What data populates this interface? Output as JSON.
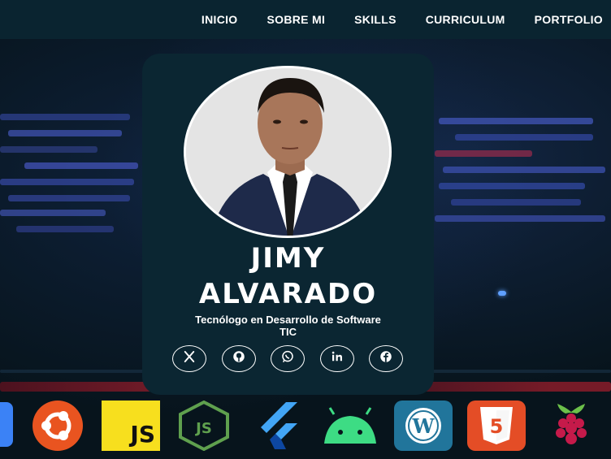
{
  "nav": {
    "items": [
      "INICIO",
      "SOBRE MI",
      "SKILLS",
      "CURRICULUM",
      "PORTFOLIO"
    ]
  },
  "profile": {
    "name_line1": "JIMY",
    "name_line2": "ALVARADO",
    "title_line1": "Tecnólogo en Desarrollo de Software",
    "title_line2": "TIC"
  },
  "social_icons": [
    "x-icon",
    "github-icon",
    "whatsapp-icon",
    "linkedin-icon",
    "facebook-icon"
  ],
  "tech_logos": {
    "js_label": "JS",
    "icons": [
      "ubuntu-icon",
      "javascript-icon",
      "nodejs-icon",
      "flutter-icon",
      "android-icon",
      "wordpress-icon",
      "html5-icon",
      "raspberry-pi-icon"
    ]
  },
  "colors": {
    "navbar_bg": "#0a2430",
    "card_bg": "#0b2632",
    "text": "#ffffff",
    "ubuntu": "#e95420",
    "javascript": "#f7df1e",
    "node": "#5fa04e",
    "flutter": "#42a5f5",
    "android": "#3ddc84",
    "wordpress": "#21759b",
    "html5": "#e44d26",
    "raspberry": "#c51a4a"
  }
}
